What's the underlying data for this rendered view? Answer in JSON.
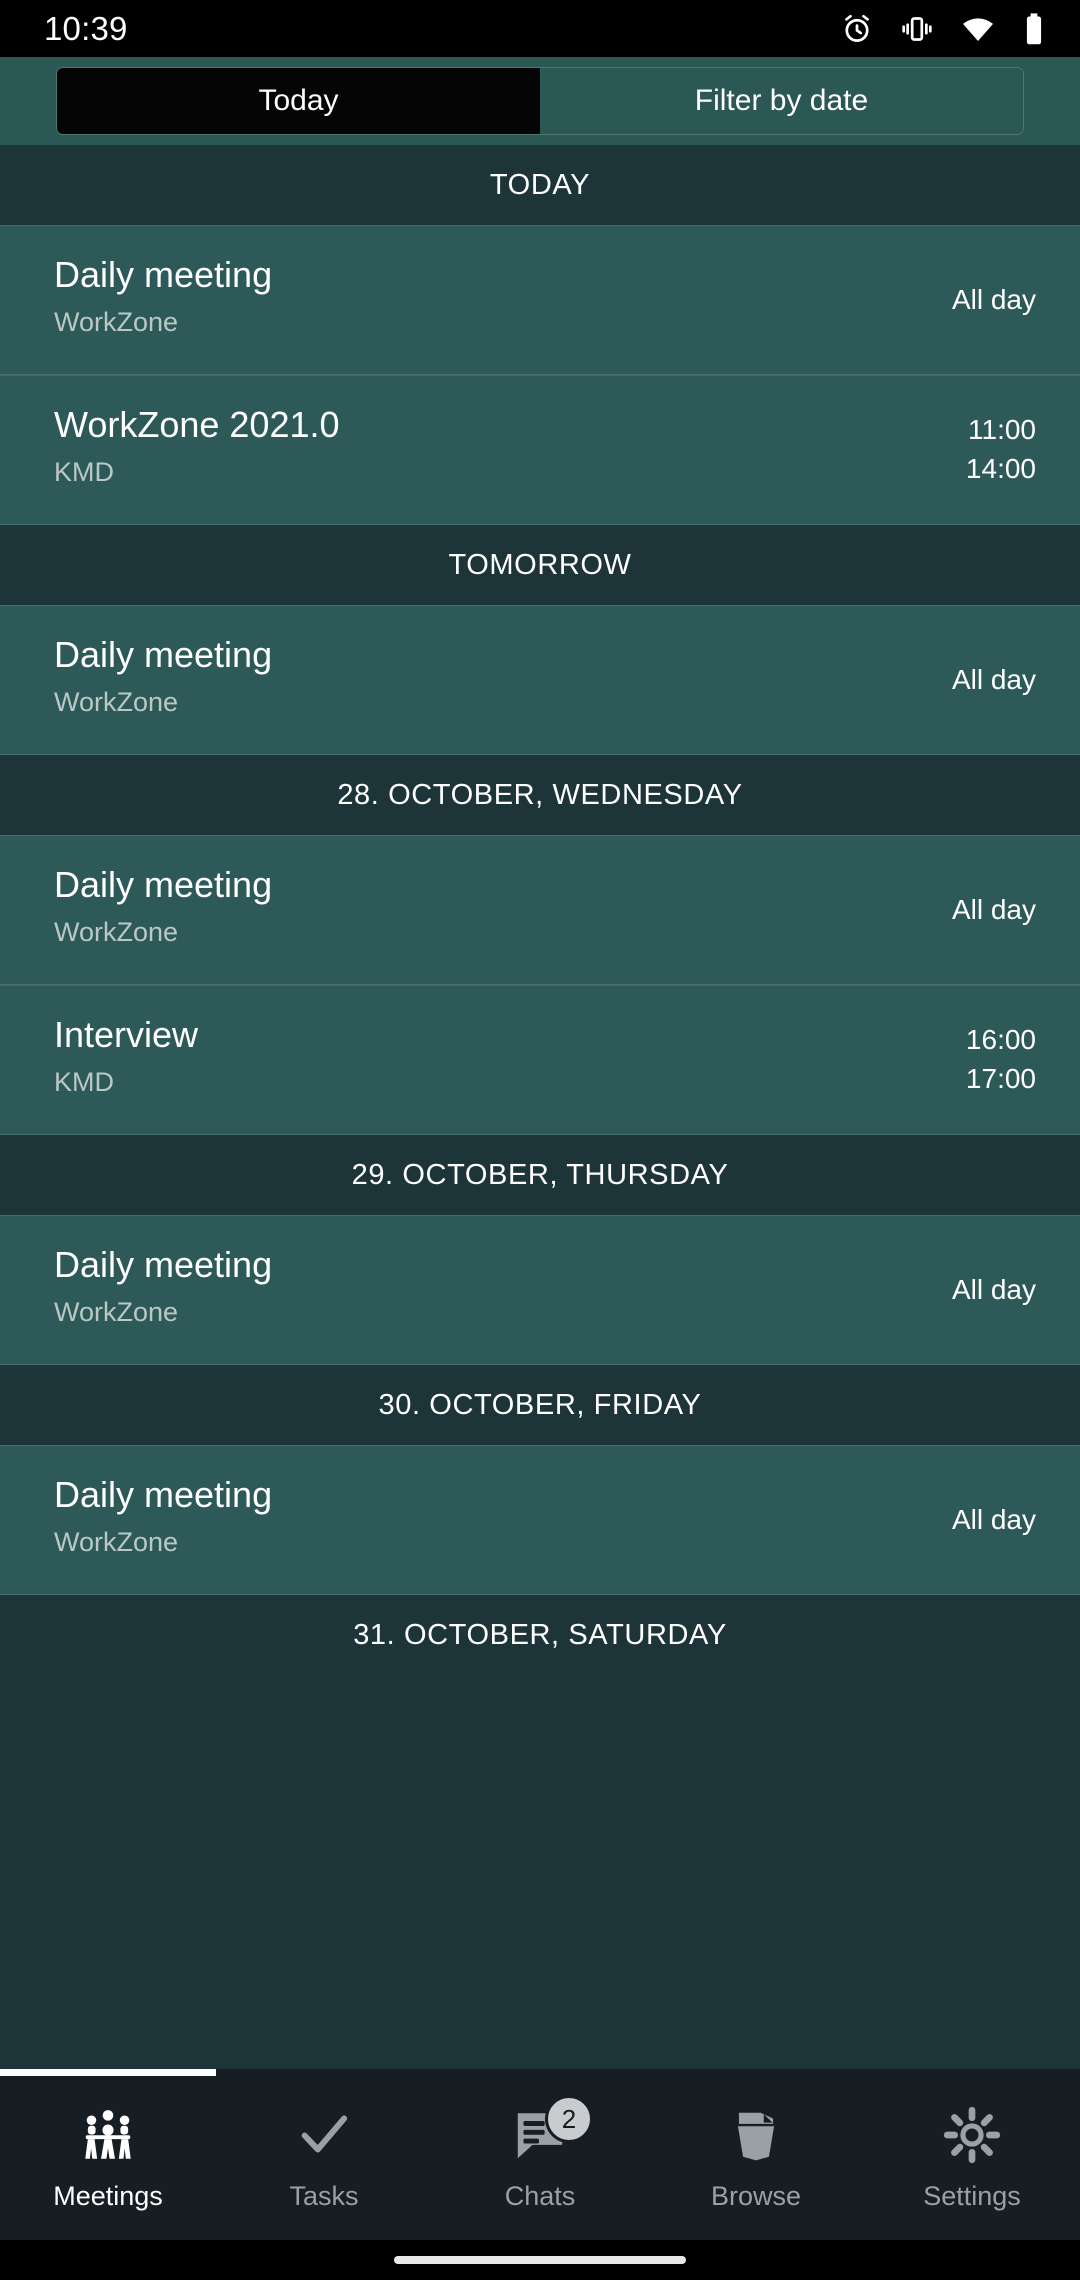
{
  "status_bar": {
    "time": "10:39",
    "icons": [
      "alarm-icon",
      "vibrate-icon",
      "wifi-icon",
      "battery-icon"
    ]
  },
  "tabs": {
    "today_label": "Today",
    "filter_label": "Filter by date",
    "selected": "Today"
  },
  "colors": {
    "header_bg": "#1D3438",
    "row_bg": "#2D5A58",
    "tab_bar_bg": "#2B5755",
    "selected_tab_bg": "#050505",
    "nav_bg": "#161D23",
    "accent_white": "#FFFFFF",
    "subtitle": "#B9C8C6",
    "nav_inactive": "#9AA0A6",
    "badge_bg": "#C9CCCE"
  },
  "sections": [
    {
      "header": "TODAY",
      "events": [
        {
          "title": "Daily meeting",
          "subtitle": "WorkZone",
          "time_start": "All day",
          "time_end": ""
        },
        {
          "title": "WorkZone 2021.0",
          "subtitle": "KMD",
          "time_start": "11:00",
          "time_end": "14:00"
        }
      ]
    },
    {
      "header": "TOMORROW",
      "events": [
        {
          "title": "Daily meeting",
          "subtitle": "WorkZone",
          "time_start": "All day",
          "time_end": ""
        }
      ]
    },
    {
      "header": "28. OCTOBER, WEDNESDAY",
      "events": [
        {
          "title": "Daily meeting",
          "subtitle": "WorkZone",
          "time_start": "All day",
          "time_end": ""
        },
        {
          "title": "Interview",
          "subtitle": "KMD",
          "time_start": "16:00",
          "time_end": "17:00"
        }
      ]
    },
    {
      "header": "29. OCTOBER, THURSDAY",
      "events": [
        {
          "title": "Daily meeting",
          "subtitle": "WorkZone",
          "time_start": "All day",
          "time_end": ""
        }
      ]
    },
    {
      "header": "30. OCTOBER, FRIDAY",
      "events": [
        {
          "title": "Daily meeting",
          "subtitle": "WorkZone",
          "time_start": "All day",
          "time_end": ""
        }
      ]
    },
    {
      "header": "31. OCTOBER, SATURDAY",
      "events": []
    }
  ],
  "bottom_nav": {
    "items": [
      {
        "label": "Meetings",
        "icon": "meeting-people-icon",
        "active": true,
        "badge": ""
      },
      {
        "label": "Tasks",
        "icon": "check-icon",
        "active": false,
        "badge": ""
      },
      {
        "label": "Chats",
        "icon": "chat-bubble-icon",
        "active": false,
        "badge": "2"
      },
      {
        "label": "Browse",
        "icon": "folder-icon",
        "active": false,
        "badge": ""
      },
      {
        "label": "Settings",
        "icon": "gear-icon",
        "active": false,
        "badge": ""
      }
    ]
  }
}
